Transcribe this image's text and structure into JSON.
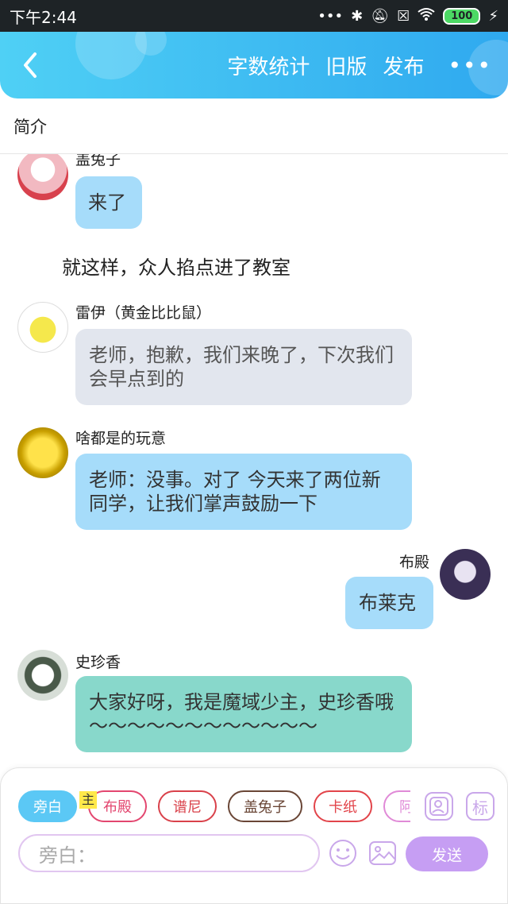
{
  "status_bar": {
    "time": "下午2:44",
    "battery": "100"
  },
  "header": {
    "actions": [
      "字数统计",
      "旧版",
      "发布"
    ],
    "more": "•••"
  },
  "intro": {
    "label": "简介"
  },
  "chat": {
    "messages": [
      {
        "name": "盖兔子",
        "text": "来了"
      },
      {
        "narration": "就这样，众人掐点进了教室"
      },
      {
        "name": "雷伊（黄金比比鼠）",
        "text": "老师，抱歉，我们来晚了，下次我们会早点到的"
      },
      {
        "name": "啥都是的玩意",
        "text": "老师：没事。对了 今天来了两位新同学，让我们掌声鼓励一下"
      },
      {
        "name": "布殿",
        "text": "布莱克"
      },
      {
        "name": "史珍香",
        "text": "大家好呀，我是魔域少主，史珍香哦～～～～～～～～～～～～"
      }
    ]
  },
  "composer": {
    "chips": [
      "旁白",
      "布殿",
      "谱尼",
      "盖兔子",
      "卡纸",
      "阿"
    ],
    "main_tag": "主",
    "mark_label": "标",
    "input_placeholder": "旁白：",
    "send_label": "发送"
  },
  "colors": {
    "header_start": "#4fd0f5",
    "header_end": "#2fa9ef",
    "bubble_blue": "#a6dcfa",
    "bubble_grey": "#e2e6ee",
    "bubble_teal": "#88d8cb",
    "send": "#c69ef3"
  }
}
